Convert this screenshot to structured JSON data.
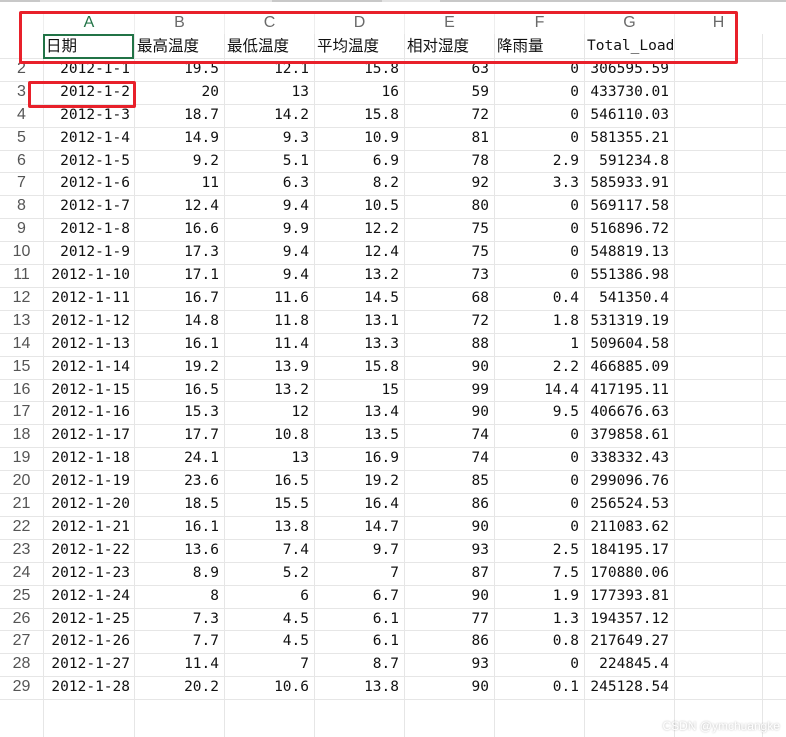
{
  "columns": [
    "A",
    "B",
    "C",
    "D",
    "E",
    "F",
    "G",
    "H"
  ],
  "header_row": {
    "row_number": "",
    "cells": [
      "日期",
      "最高温度",
      "最低温度",
      "平均温度",
      "相对湿度",
      "降雨量",
      "Total_Load",
      ""
    ]
  },
  "rows": [
    {
      "n": "2",
      "cells": [
        "2012-1-1",
        "19.5",
        "12.1",
        "15.8",
        "63",
        "0",
        "306595.59"
      ]
    },
    {
      "n": "3",
      "cells": [
        "2012-1-2",
        "20",
        "13",
        "16",
        "59",
        "0",
        "433730.01"
      ]
    },
    {
      "n": "4",
      "cells": [
        "2012-1-3",
        "18.7",
        "14.2",
        "15.8",
        "72",
        "0",
        "546110.03"
      ]
    },
    {
      "n": "5",
      "cells": [
        "2012-1-4",
        "14.9",
        "9.3",
        "10.9",
        "81",
        "0",
        "581355.21"
      ]
    },
    {
      "n": "6",
      "cells": [
        "2012-1-5",
        "9.2",
        "5.1",
        "6.9",
        "78",
        "2.9",
        "591234.8"
      ]
    },
    {
      "n": "7",
      "cells": [
        "2012-1-6",
        "11",
        "6.3",
        "8.2",
        "92",
        "3.3",
        "585933.91"
      ]
    },
    {
      "n": "8",
      "cells": [
        "2012-1-7",
        "12.4",
        "9.4",
        "10.5",
        "80",
        "0",
        "569117.58"
      ]
    },
    {
      "n": "9",
      "cells": [
        "2012-1-8",
        "16.6",
        "9.9",
        "12.2",
        "75",
        "0",
        "516896.72"
      ]
    },
    {
      "n": "10",
      "cells": [
        "2012-1-9",
        "17.3",
        "9.4",
        "12.4",
        "75",
        "0",
        "548819.13"
      ]
    },
    {
      "n": "11",
      "cells": [
        "2012-1-10",
        "17.1",
        "9.4",
        "13.2",
        "73",
        "0",
        "551386.98"
      ]
    },
    {
      "n": "12",
      "cells": [
        "2012-1-11",
        "16.7",
        "11.6",
        "14.5",
        "68",
        "0.4",
        "541350.4"
      ]
    },
    {
      "n": "13",
      "cells": [
        "2012-1-12",
        "14.8",
        "11.8",
        "13.1",
        "72",
        "1.8",
        "531319.19"
      ]
    },
    {
      "n": "14",
      "cells": [
        "2012-1-13",
        "16.1",
        "11.4",
        "13.3",
        "88",
        "1",
        "509604.58"
      ]
    },
    {
      "n": "15",
      "cells": [
        "2012-1-14",
        "19.2",
        "13.9",
        "15.8",
        "90",
        "2.2",
        "466885.09"
      ]
    },
    {
      "n": "16",
      "cells": [
        "2012-1-15",
        "16.5",
        "13.2",
        "15",
        "99",
        "14.4",
        "417195.11"
      ]
    },
    {
      "n": "17",
      "cells": [
        "2012-1-16",
        "15.3",
        "12",
        "13.4",
        "90",
        "9.5",
        "406676.63"
      ]
    },
    {
      "n": "18",
      "cells": [
        "2012-1-17",
        "17.7",
        "10.8",
        "13.5",
        "74",
        "0",
        "379858.61"
      ]
    },
    {
      "n": "19",
      "cells": [
        "2012-1-18",
        "24.1",
        "13",
        "16.9",
        "74",
        "0",
        "338332.43"
      ]
    },
    {
      "n": "20",
      "cells": [
        "2012-1-19",
        "23.6",
        "16.5",
        "19.2",
        "85",
        "0",
        "299096.76"
      ]
    },
    {
      "n": "21",
      "cells": [
        "2012-1-20",
        "18.5",
        "15.5",
        "16.4",
        "86",
        "0",
        "256524.53"
      ]
    },
    {
      "n": "22",
      "cells": [
        "2012-1-21",
        "16.1",
        "13.8",
        "14.7",
        "90",
        "0",
        "211083.62"
      ]
    },
    {
      "n": "23",
      "cells": [
        "2012-1-22",
        "13.6",
        "7.4",
        "9.7",
        "93",
        "2.5",
        "184195.17"
      ]
    },
    {
      "n": "24",
      "cells": [
        "2012-1-23",
        "8.9",
        "5.2",
        "7",
        "87",
        "7.5",
        "170880.06"
      ]
    },
    {
      "n": "25",
      "cells": [
        "2012-1-24",
        "8",
        "6",
        "6.7",
        "90",
        "1.9",
        "177393.81"
      ]
    },
    {
      "n": "26",
      "cells": [
        "2012-1-25",
        "7.3",
        "4.5",
        "6.1",
        "77",
        "1.3",
        "194357.12"
      ]
    },
    {
      "n": "27",
      "cells": [
        "2012-1-26",
        "7.7",
        "4.5",
        "6.1",
        "86",
        "0.8",
        "217649.27"
      ]
    },
    {
      "n": "28",
      "cells": [
        "2012-1-27",
        "11.4",
        "7",
        "8.7",
        "93",
        "0",
        "224845.4"
      ]
    },
    {
      "n": "29",
      "cells": [
        "2012-1-28",
        "20.2",
        "10.6",
        "13.8",
        "90",
        "0.1",
        "245128.54"
      ]
    }
  ],
  "watermark": "CSDN @ymchuangke",
  "colors": {
    "selection": "#217346",
    "highlight_box": "#e8202a",
    "grid": "#e6e6e6"
  }
}
